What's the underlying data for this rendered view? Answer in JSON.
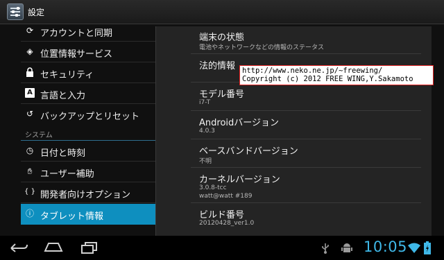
{
  "header": {
    "title": "設定",
    "icon": "settings-icon"
  },
  "sidebar": {
    "items": [
      {
        "label": "アカウントと同期",
        "icon": "sync-icon",
        "glyph": "⟳"
      },
      {
        "label": "位置情報サービス",
        "icon": "location-icon",
        "glyph": "◈"
      },
      {
        "label": "セキュリティ",
        "icon": "lock-icon",
        "glyph": "🔒︎"
      },
      {
        "label": "言語と入力",
        "icon": "keyboard-language-icon",
        "glyph": "A"
      },
      {
        "label": "バックアップとリセット",
        "icon": "backup-restore-icon",
        "glyph": "↺"
      }
    ],
    "section_label": "システム",
    "system_items": [
      {
        "label": "日付と時刻",
        "icon": "clock-icon",
        "glyph": "◷"
      },
      {
        "label": "ユーザー補助",
        "icon": "hand-icon",
        "glyph": "✋︎"
      },
      {
        "label": "開発者向けオプション",
        "icon": "braces-icon",
        "glyph": "{ }"
      },
      {
        "label": "タブレット情報",
        "icon": "info-icon",
        "glyph": "ⓘ"
      }
    ]
  },
  "details": {
    "items": [
      {
        "title": "端末の状態",
        "summary": "電池やネットワークなどの情報のステータス"
      },
      {
        "title": "法的情報",
        "summary": ""
      },
      {
        "title": "モデル番号",
        "summary": "i7-T"
      },
      {
        "title": "Androidバージョン",
        "summary": "4.0.3"
      },
      {
        "title": "ベースバンドバージョン",
        "summary": "不明"
      },
      {
        "title": "カーネルバージョン",
        "summary": "3.0.8-tcc",
        "summary2": "watt@watt #189"
      },
      {
        "title": "ビルド番号",
        "summary": "20120428_ver1.0"
      }
    ]
  },
  "watermark": {
    "line1": "http://www.neko.ne.jp/~freewing/",
    "line2": "Copyright (c) 2012 FREE WING,Y.Sakamoto"
  },
  "statusbar": {
    "time": "10:05"
  },
  "colors": {
    "accent": "#0e8fbf",
    "clock": "#3fb8e8",
    "background": "#101010",
    "panel": "#242424"
  }
}
